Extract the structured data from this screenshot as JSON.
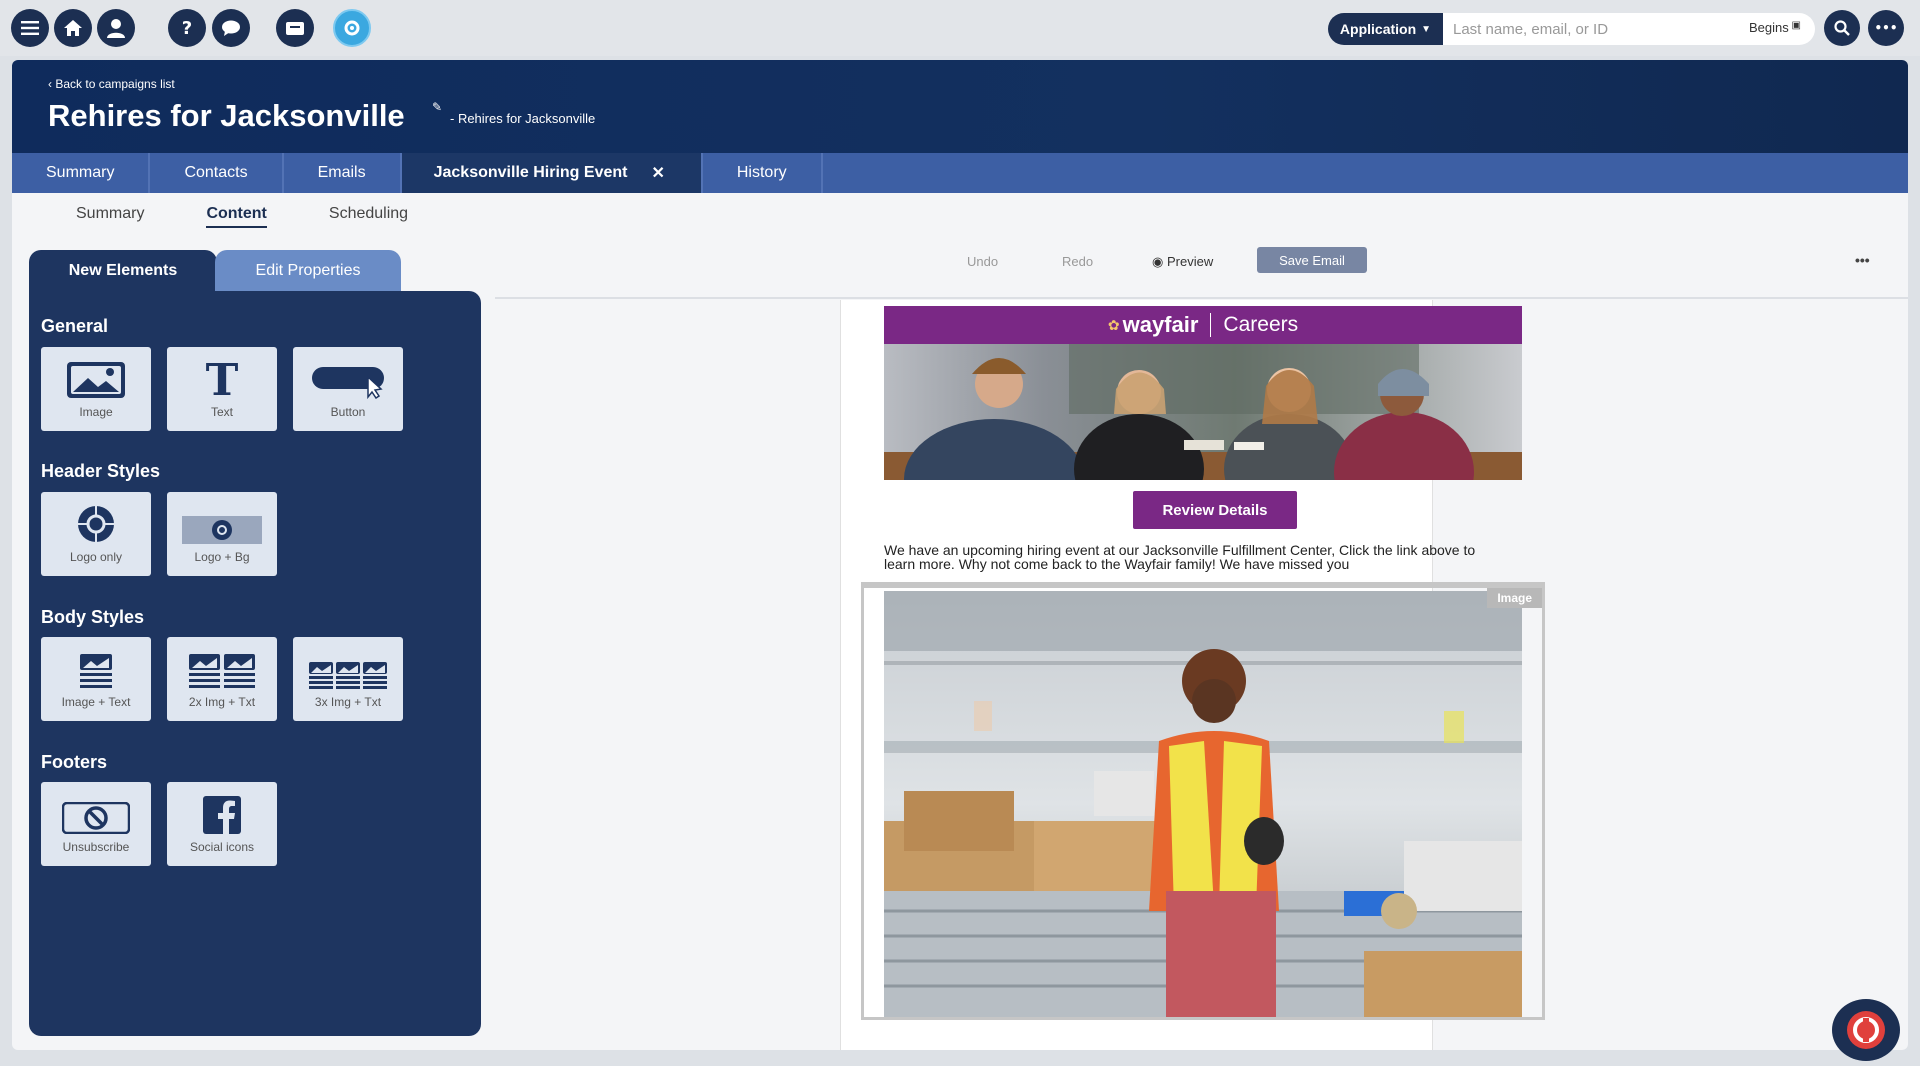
{
  "toolbar": {
    "icons": [
      "menu-icon",
      "home-icon",
      "user-icon",
      "help-icon",
      "chat-icon",
      "inbox-icon",
      "settings-icon"
    ],
    "app_selector": "Application",
    "search_placeholder": "Last name, email, or ID",
    "search_mode": "Begins"
  },
  "header": {
    "back_link": "Back to campaigns list",
    "title": "Rehires for Jacksonville",
    "subtitle": "- Rehires for Jacksonville"
  },
  "tabs": [
    {
      "label": "Summary"
    },
    {
      "label": "Contacts"
    },
    {
      "label": "Emails"
    },
    {
      "label": "Jacksonville Hiring Event",
      "active": true
    },
    {
      "label": "History"
    }
  ],
  "subtabs": [
    {
      "label": "Summary"
    },
    {
      "label": "Content",
      "active": true
    },
    {
      "label": "Scheduling"
    }
  ],
  "panel": {
    "tab_new": "New Elements",
    "tab_edit": "Edit Properties",
    "sections": {
      "general": "General",
      "header": "Header Styles",
      "body": "Body Styles",
      "footers": "Footers"
    },
    "tiles": {
      "image": "Image",
      "text": "Text",
      "button": "Button",
      "logo_only": "Logo only",
      "logo_bg": "Logo + Bg",
      "image_text": "Image + Text",
      "img2": "2x Img + Txt",
      "img3": "3x Img + Txt",
      "unsubscribe": "Unsubscribe",
      "social": "Social icons"
    }
  },
  "editor": {
    "undo": "Undo",
    "redo": "Redo",
    "preview": "Preview",
    "save": "Save Email",
    "more": "•••"
  },
  "email": {
    "brand": "wayfair",
    "brand_suffix": "Careers",
    "button": "Review Details",
    "body": "We have an upcoming hiring event at our Jacksonville Fulfillment Center, Click the link above to learn more. Why not come back to the Wayfair family! We have missed you",
    "image_tag": "Image"
  },
  "colors": {
    "navy": "#1c2f52",
    "tab_blue": "#3d5fa4",
    "brand_purple": "#7a2885"
  }
}
